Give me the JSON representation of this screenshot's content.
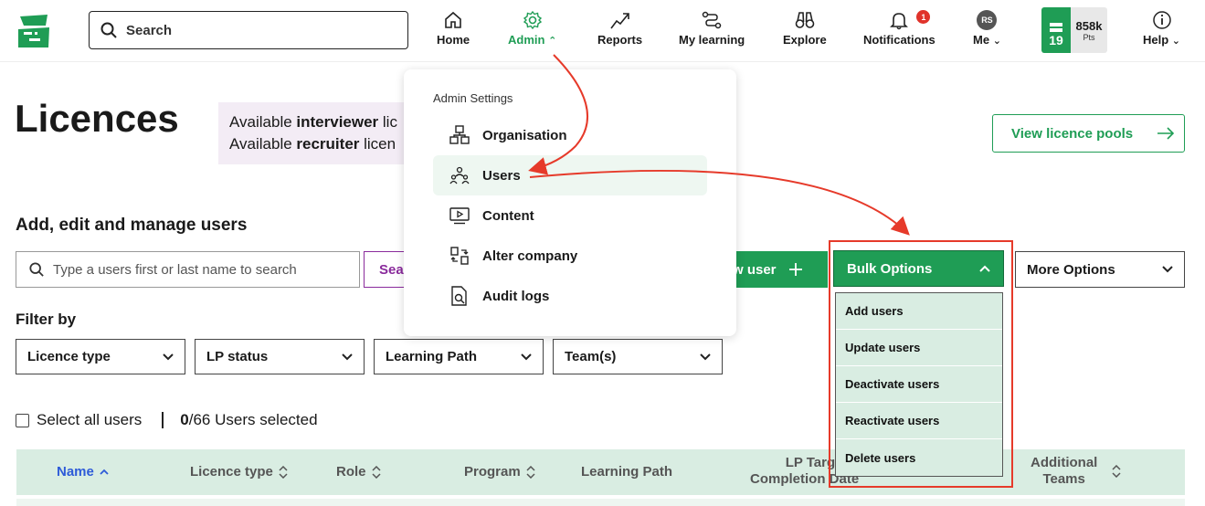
{
  "nav": {
    "search_label": "Search",
    "home": "Home",
    "admin": "Admin",
    "reports": "Reports",
    "my_learning": "My learning",
    "explore": "Explore",
    "notifications": "Notifications",
    "notifications_count": "1",
    "me": "Me",
    "avatar_initials": "RS",
    "level": "19",
    "points": "858k",
    "points_unit": "Pts",
    "help": "Help"
  },
  "page": {
    "title": "Licences",
    "info_line1_prefix": "Available ",
    "info_line1_bold": "interviewer",
    "info_line1_suffix": " lic",
    "info_line2_prefix": "Available ",
    "info_line2_bold": "recruiter",
    "info_line2_suffix": " licen",
    "view_pools": "View licence pools",
    "subtitle": "Add, edit and manage users",
    "user_search_placeholder": "Type a users first or last name to search",
    "search_button": "Sea",
    "new_user_button": "w user",
    "bulk_options": "Bulk Options",
    "more_options": "More Options",
    "filter_by": "Filter by",
    "filters": [
      "Licence type",
      "LP status",
      "Learning Path",
      "Team(s)"
    ],
    "select_all": "Select all users",
    "selected_count": "0",
    "selected_suffix": "/66 Users selected"
  },
  "table": {
    "headers": [
      "Name",
      "Licence type",
      "Role",
      "Program",
      "Learning Path",
      "LP Target",
      "Completion Date",
      "Additional",
      "Teams"
    ]
  },
  "admin_menu": {
    "header": "Admin Settings",
    "items": [
      "Organisation",
      "Users",
      "Content",
      "Alter company",
      "Audit logs"
    ]
  },
  "bulk_menu": {
    "items": [
      "Add users",
      "Update users",
      "Deactivate users",
      "Reactivate users",
      "Delete users"
    ]
  },
  "colors": {
    "brand_green": "#1f9d55",
    "annotation_red": "#e63a2a",
    "accent_purple": "#8a2b9c",
    "sort_blue": "#2e5bd8"
  }
}
